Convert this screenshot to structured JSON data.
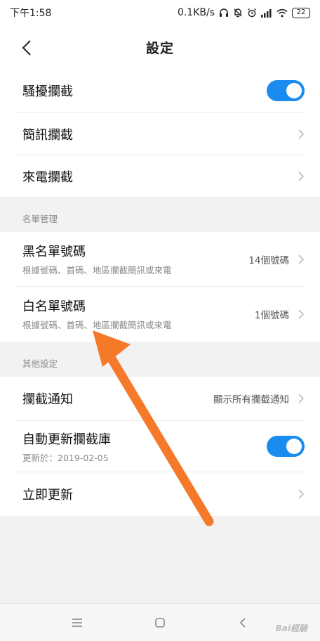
{
  "status_bar": {
    "time": "下午1:58",
    "network_speed": "0.1KB/s",
    "battery": "22",
    "icons": [
      "headphones-icon",
      "mute-bell-icon",
      "alarm-icon",
      "signal-icon",
      "wifi-icon",
      "battery-icon"
    ]
  },
  "header": {
    "title": "設定",
    "back_icon": "chevron-left-icon"
  },
  "blocking": {
    "items": [
      {
        "label": "騷擾攔截",
        "control": "toggle",
        "on": true
      },
      {
        "label": "簡訊攔截",
        "control": "chevron"
      },
      {
        "label": "來電攔截",
        "control": "chevron"
      }
    ]
  },
  "list_management": {
    "header": "名單管理",
    "items": [
      {
        "label": "黑名單號碼",
        "sub": "根據號碼、首碼、地區攔截簡訊或來電",
        "value": "14個號碼"
      },
      {
        "label": "白名單號碼",
        "sub": "根據號碼、首碼、地區攔截簡訊或來電",
        "value": "1個號碼"
      }
    ]
  },
  "other_settings": {
    "header": "其他設定",
    "items": [
      {
        "label": "攔截通知",
        "value": "顯示所有攔截通知",
        "control": "chevron"
      },
      {
        "label": "自動更新攔截庫",
        "sub": "更新於：2019-02-05",
        "control": "toggle",
        "on": true
      },
      {
        "label": "立即更新",
        "control": "chevron"
      }
    ]
  },
  "nav_bar": {
    "icons": [
      "menu-icon",
      "home-square-icon",
      "back-triangle-icon"
    ]
  },
  "watermark": "Bai經驗",
  "colors": {
    "accent": "#1a8cf0",
    "background": "#f2f2f2",
    "arrow": "#f47a2a"
  }
}
